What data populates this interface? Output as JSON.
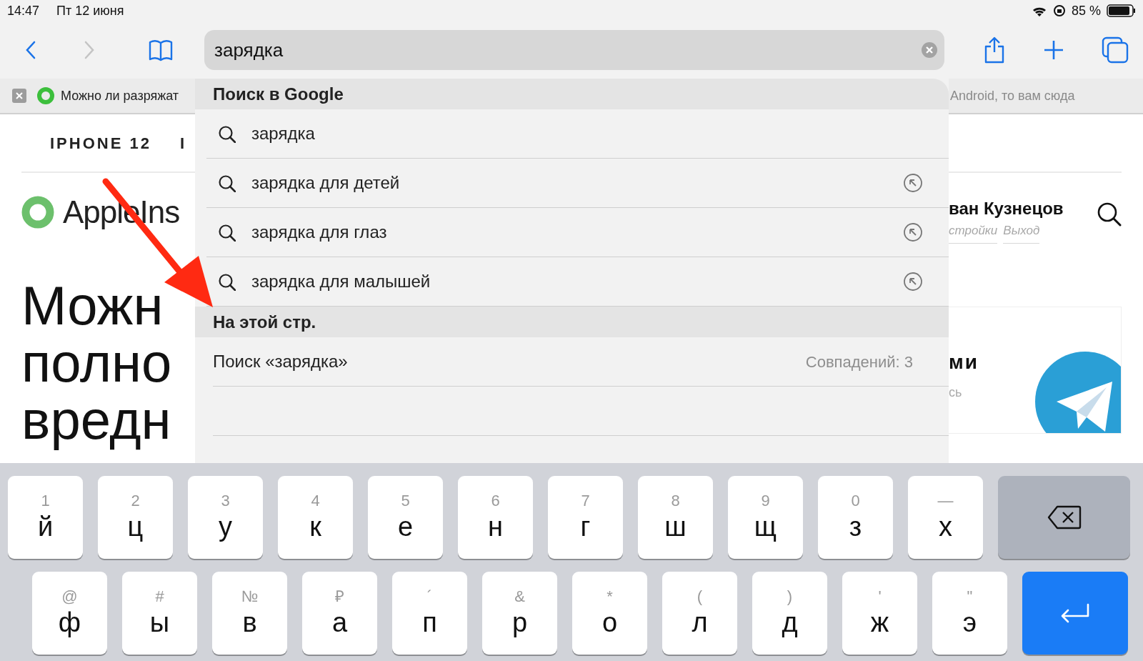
{
  "status_bar": {
    "time": "14:47",
    "date": "Пт 12 июня",
    "battery": "85 %"
  },
  "toolbar": {
    "back": {
      "disabled": false
    },
    "forward": {
      "disabled": true
    },
    "address": {
      "value": "зарядка"
    }
  },
  "tab_strip": {
    "left_title": "Можно ли разряжат",
    "right_title": "Android, то вам сюда"
  },
  "page": {
    "nav": [
      "IPHONE 12",
      "I"
    ],
    "logo": "AppleIns",
    "headline": [
      "Можн",
      "полно",
      "вредн"
    ],
    "user": "ван Кузнецов",
    "user_links": [
      "стройки",
      "Выход"
    ],
    "card_title": "ми",
    "card_subtitle": "сь"
  },
  "suggestions": {
    "google_header": "Поиск в Google",
    "items": [
      {
        "text": "зарядка",
        "fill_button": false
      },
      {
        "text": "зарядка для детей",
        "fill_button": true
      },
      {
        "text": "зарядка для глаз",
        "fill_button": true
      },
      {
        "text": "зарядка для малышей",
        "fill_button": true
      }
    ],
    "page_header": "На этой стр.",
    "find": {
      "text": "Поиск «зарядка»",
      "matches": "Совпадений: 3"
    }
  },
  "keyboard": {
    "rows": [
      [
        {
          "kind": "letter",
          "main": "й",
          "alt": "1"
        },
        {
          "kind": "letter",
          "main": "ц",
          "alt": "2"
        },
        {
          "kind": "letter",
          "main": "у",
          "alt": "3"
        },
        {
          "kind": "letter",
          "main": "к",
          "alt": "4"
        },
        {
          "kind": "letter",
          "main": "е",
          "alt": "5"
        },
        {
          "kind": "letter",
          "main": "н",
          "alt": "6"
        },
        {
          "kind": "letter",
          "main": "г",
          "alt": "7"
        },
        {
          "kind": "letter",
          "main": "ш",
          "alt": "8"
        },
        {
          "kind": "letter",
          "main": "щ",
          "alt": "9"
        },
        {
          "kind": "letter",
          "main": "з",
          "alt": "0"
        },
        {
          "kind": "letter",
          "main": "х",
          "alt": "—"
        },
        {
          "kind": "backspace"
        }
      ],
      [
        {
          "kind": "letter",
          "main": "ф",
          "alt": "@"
        },
        {
          "kind": "letter",
          "main": "ы",
          "alt": "#"
        },
        {
          "kind": "letter",
          "main": "в",
          "alt": "№"
        },
        {
          "kind": "letter",
          "main": "а",
          "alt": "₽"
        },
        {
          "kind": "letter",
          "main": "п",
          "alt": "´"
        },
        {
          "kind": "letter",
          "main": "р",
          "alt": "&"
        },
        {
          "kind": "letter",
          "main": "о",
          "alt": "*"
        },
        {
          "kind": "letter",
          "main": "л",
          "alt": "("
        },
        {
          "kind": "letter",
          "main": "д",
          "alt": ")"
        },
        {
          "kind": "letter",
          "main": "ж",
          "alt": "'"
        },
        {
          "kind": "letter",
          "main": "э",
          "alt": "\""
        },
        {
          "kind": "return"
        }
      ]
    ]
  }
}
